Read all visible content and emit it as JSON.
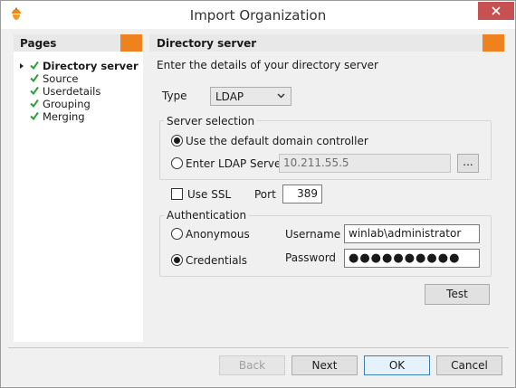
{
  "window": {
    "title": "Import Organization",
    "icon": "acorn-icon",
    "close_icon": "close-icon"
  },
  "sidebar": {
    "title": "Pages",
    "items": [
      {
        "label": "Directory server",
        "active": true,
        "checked": true
      },
      {
        "label": "Source",
        "active": false,
        "checked": true
      },
      {
        "label": "Userdetails",
        "active": false,
        "checked": true
      },
      {
        "label": "Grouping",
        "active": false,
        "checked": true
      },
      {
        "label": "Merging",
        "active": false,
        "checked": true
      }
    ]
  },
  "main": {
    "title": "Directory server",
    "description": "Enter the details of your directory server",
    "type_label": "Type",
    "type_value": "LDAP",
    "server_selection": {
      "legend": "Server selection",
      "default_option": "Use the default domain controller",
      "ldap_option": "Enter LDAP Server:",
      "ldap_value": "10.211.55.5",
      "browse_label": "...",
      "selected": "default"
    },
    "ssl_label": "Use SSL",
    "ssl_checked": false,
    "port_label": "Port",
    "port_value": "389",
    "authentication": {
      "legend": "Authentication",
      "anonymous_label": "Anonymous",
      "credentials_label": "Credentials",
      "selected": "credentials",
      "username_label": "Username",
      "username_value": "winlab\\administrator",
      "password_label": "Password",
      "password_value": "●●●●●●●●●●"
    },
    "test_label": "Test"
  },
  "footer": {
    "back_label": "Back",
    "next_label": "Next",
    "ok_label": "OK",
    "cancel_label": "Cancel"
  },
  "colors": {
    "accent": "#f0821e",
    "check": "#2f9e3a",
    "close": "#c75050"
  }
}
